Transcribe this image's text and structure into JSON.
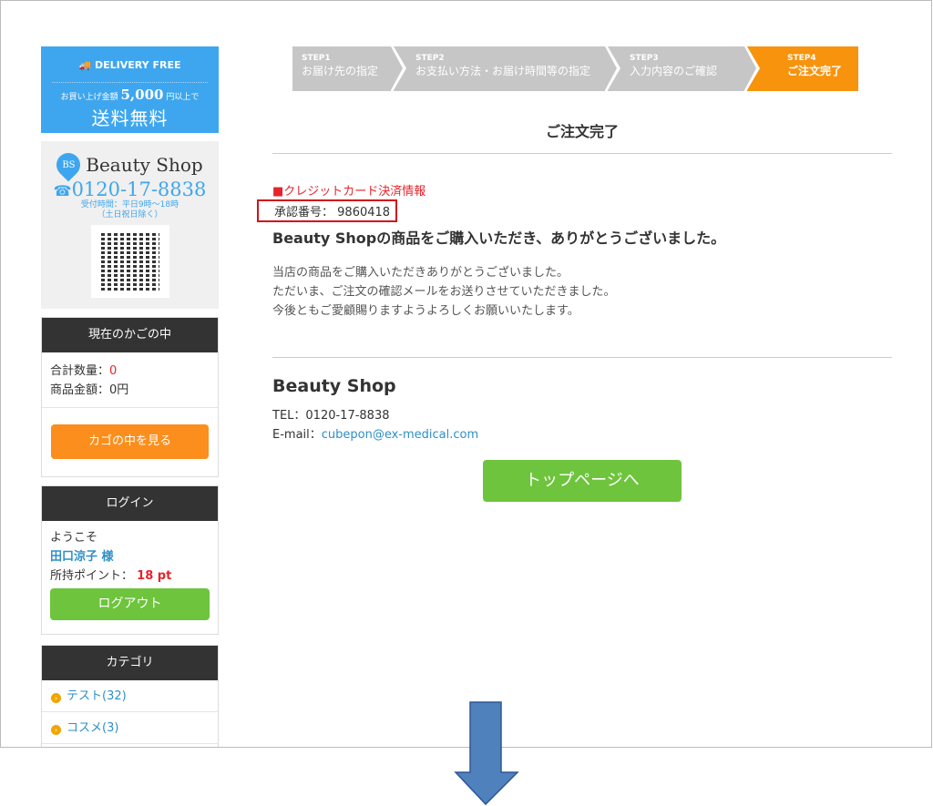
{
  "promo": {
    "badge": "DELIVERY FREE",
    "condition_prefix": "お買い上げ金額",
    "amount": "5,000",
    "condition_suffix": "円以上で",
    "headline": "送料無料"
  },
  "shop_card": {
    "logo_initials": "BS",
    "name": "Beauty Shop",
    "phone": "0120-17-8838",
    "hours": "受付時間：平日9時～18時",
    "hours_note": "（土日祝日除く）"
  },
  "cart": {
    "title": "現在のかごの中",
    "qty_label": "合計数量：",
    "qty": "0",
    "amount_label": "商品金額：",
    "amount": "0円",
    "view_button": "カゴの中を見る"
  },
  "login": {
    "title": "ログイン",
    "welcome": "ようこそ",
    "user": "田口涼子 様",
    "points_label": "所持ポイント：",
    "points": "18 pt",
    "logout_button": "ログアウト"
  },
  "category": {
    "title": "カテゴリ",
    "items": [
      {
        "label": "テスト(32)"
      },
      {
        "label": "コスメ(3)"
      }
    ]
  },
  "steps": [
    {
      "num": "STEP1",
      "label": "お届け先の指定"
    },
    {
      "num": "STEP2",
      "label": "お支払い方法・お届け時間等の指定"
    },
    {
      "num": "STEP3",
      "label": "入力内容のご確認"
    },
    {
      "num": "STEP4",
      "label": "ご注文完了"
    }
  ],
  "colors": {
    "active_step": "#f7930d",
    "step": "#c6c6c6",
    "highlight_box": "#d0121b",
    "arrow": "#4f81bd"
  },
  "main": {
    "title": "ご注文完了",
    "cc_info": "■クレジットカード決済情報",
    "approval_label": "承認番号：",
    "approval_number": "9860418",
    "thanks": "Beauty Shopの商品をご購入いただき、ありがとうございました。",
    "messages": [
      "当店の商品をご購入いただきありがとうございました。",
      "ただいま、ご注文の確認メールをお送りさせていただきました。",
      "今後ともご愛顧賜りますようよろしくお願いいたします。"
    ],
    "shop_name": "Beauty Shop",
    "tel": "TEL：0120-17-8838",
    "email_label": "E-mail：",
    "email": "cubepon@ex-medical.com",
    "top_button": "トップページへ"
  }
}
